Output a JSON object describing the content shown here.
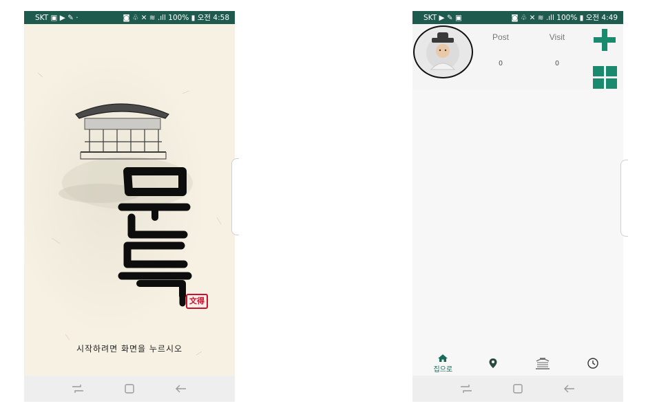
{
  "left_screen": {
    "status": {
      "left": "SKT ▣ ▶ ✎ ·",
      "right": "◙ ♧ ✕ ≋ .ıll 100% ▮ 오전 4:58"
    },
    "splash": {
      "calligraphy": "문득",
      "seal_text": "文得",
      "prompt": "시작하려면 화면을 누르시오"
    },
    "nav_icons": [
      "recent-apps-icon",
      "home-icon",
      "back-icon"
    ]
  },
  "right_screen": {
    "status": {
      "left": "SKT ▶ ✎ ▣",
      "right": "◙ ♧ ✕ ≋ .ıll 100% ▮ 오전 4:49"
    },
    "profile": {
      "post_label": "Post",
      "visit_label": "Visit",
      "post_count": "0",
      "visit_count": "0"
    },
    "tabs": [
      {
        "icon": "home-icon",
        "label": "집으로",
        "active": true
      },
      {
        "icon": "map-pin-icon",
        "label": "",
        "active": false
      },
      {
        "icon": "pavilion-icon",
        "label": "",
        "active": false
      },
      {
        "icon": "clock-icon",
        "label": "",
        "active": false
      }
    ],
    "nav_icons": [
      "recent-apps-icon",
      "home-icon",
      "back-icon"
    ]
  },
  "colors": {
    "status_bar": "#1f5a4e",
    "accent": "#1a8a6e",
    "splash_background": "#f6f1e2",
    "seal_red": "#c8102e"
  }
}
